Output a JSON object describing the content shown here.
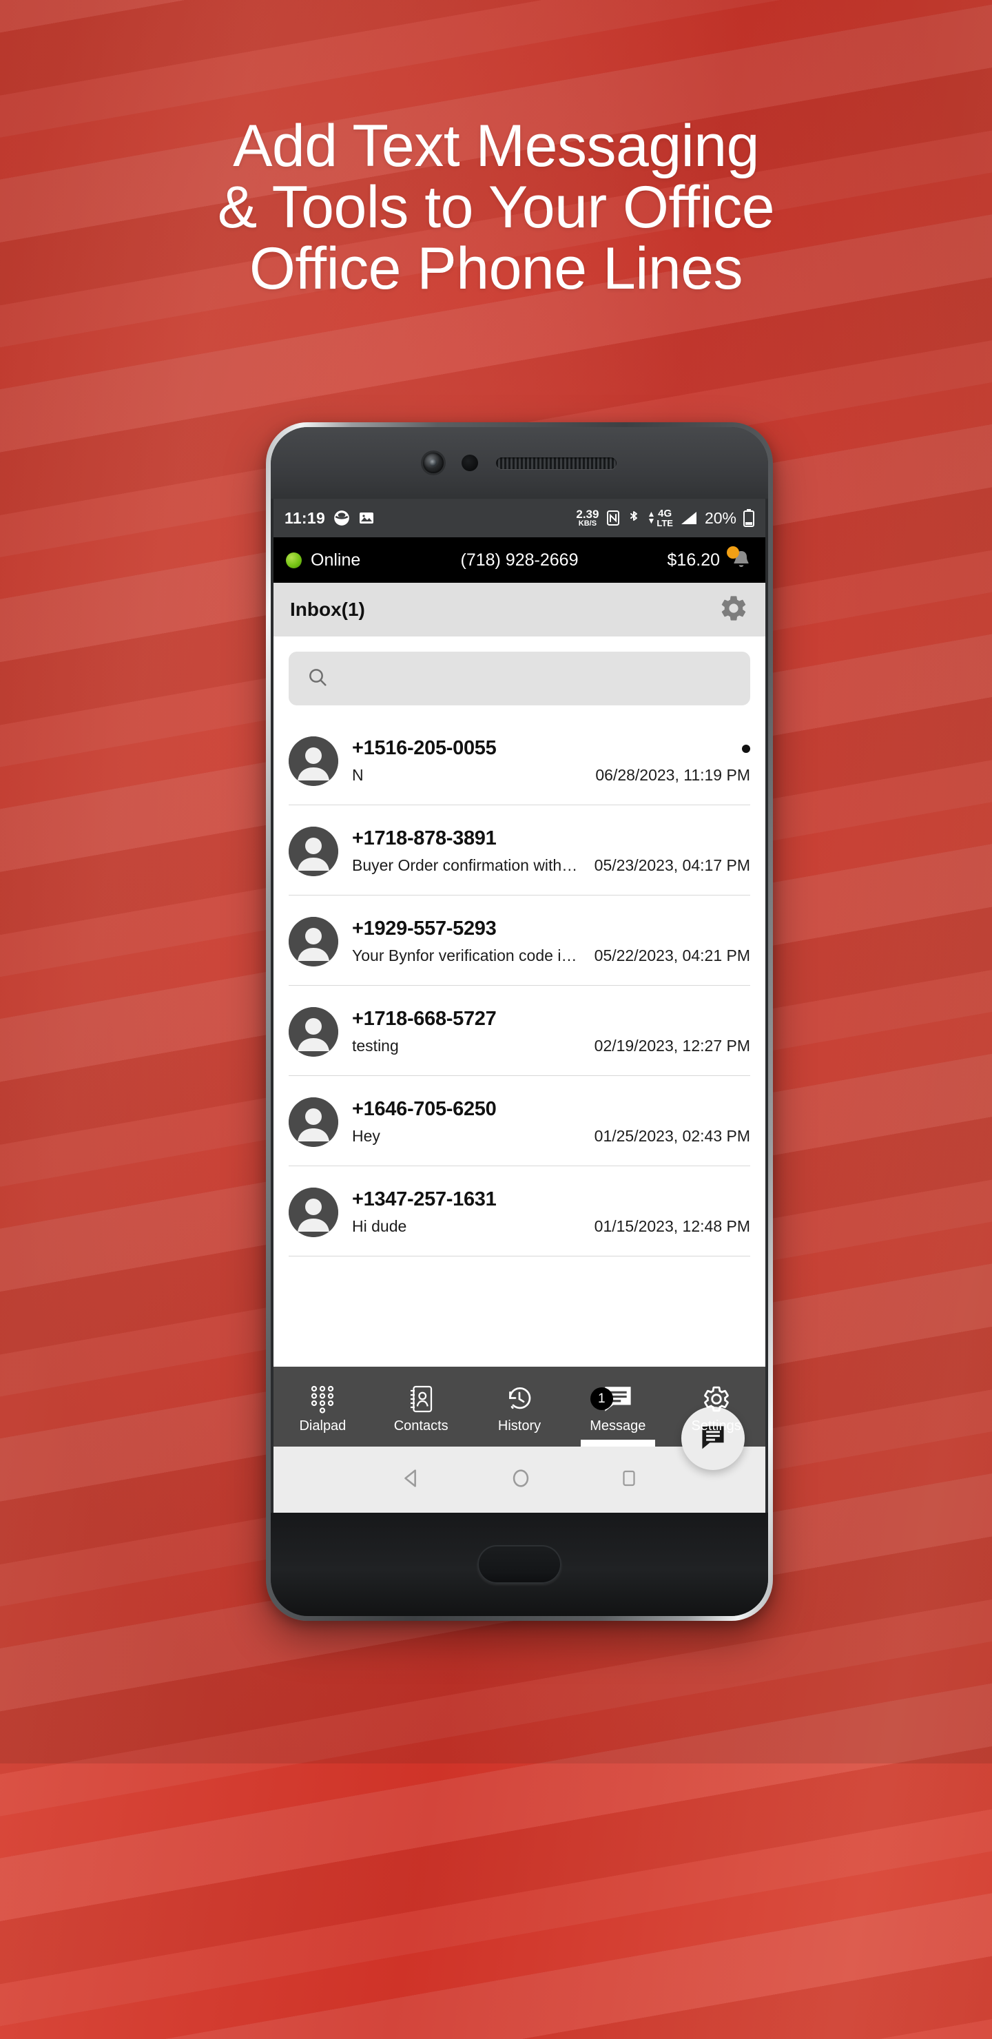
{
  "promo": {
    "headline_lines": [
      "Add Text Messaging",
      "& Tools to Your Office",
      "Office Phone Lines"
    ],
    "background_color": "#d2392f",
    "headline_color": "#ffffff"
  },
  "phone": {
    "android_status_bar": {
      "clock": "11:19",
      "left_icons": [
        "app-notification-icon",
        "screenshot-image-icon"
      ],
      "data_rate_value": "2.39",
      "data_rate_unit": "KB/S",
      "nfc_icon": "nfc-icon",
      "bluetooth_icon": "bluetooth-icon",
      "network_type_line1": "4G",
      "network_type_line2": "LTE",
      "signal_icon": "signal-bars-icon",
      "battery_percent": "20%",
      "battery_icon": "battery-icon"
    },
    "account_bar": {
      "presence_status": "Online",
      "presence_color": "#7dc81a",
      "phone_number": "(718) 928-2669",
      "balance": "$16.20",
      "bell_icon": "notification-bell-icon",
      "bell_badge_color": "#f2a015"
    },
    "inbox_header": {
      "title": "Inbox(1)",
      "settings_icon": "gear-icon"
    },
    "search": {
      "placeholder": "",
      "value": "",
      "icon": "search-icon"
    },
    "conversations": [
      {
        "number": "+1516-205-0055",
        "preview": "N",
        "timestamp": "06/28/2023, 11:19 PM",
        "unread": true
      },
      {
        "number": "+1718-878-3891",
        "preview": "Buyer Order confirmation with O…",
        "timestamp": "05/23/2023, 04:17 PM",
        "unread": false
      },
      {
        "number": "+1929-557-5293",
        "preview": "Your Bynfor verification code is…",
        "timestamp": "05/22/2023, 04:21 PM",
        "unread": false
      },
      {
        "number": "+1718-668-5727",
        "preview": "testing",
        "timestamp": "02/19/2023, 12:27 PM",
        "unread": false
      },
      {
        "number": "+1646-705-6250",
        "preview": "Hey",
        "timestamp": "01/25/2023, 02:43 PM",
        "unread": false
      },
      {
        "number": "+1347-257-1631",
        "preview": "Hi dude",
        "timestamp": "01/15/2023, 12:48 PM",
        "unread": false
      }
    ],
    "compose_fab": {
      "icon": "message-compose-icon"
    },
    "bottom_tabs": [
      {
        "label": "Dialpad",
        "icon": "dialpad-icon",
        "active": false,
        "badge": ""
      },
      {
        "label": "Contacts",
        "icon": "contacts-book-icon",
        "active": false,
        "badge": ""
      },
      {
        "label": "History",
        "icon": "history-clock-icon",
        "active": false,
        "badge": ""
      },
      {
        "label": "Message",
        "icon": "message-icon",
        "active": true,
        "badge": "1"
      },
      {
        "label": "Settings",
        "icon": "gear-icon",
        "active": false,
        "badge": ""
      }
    ],
    "android_nav_bar": {
      "back_icon": "back-triangle-icon",
      "home_icon": "home-circle-icon",
      "recents_icon": "recents-square-icon"
    }
  }
}
